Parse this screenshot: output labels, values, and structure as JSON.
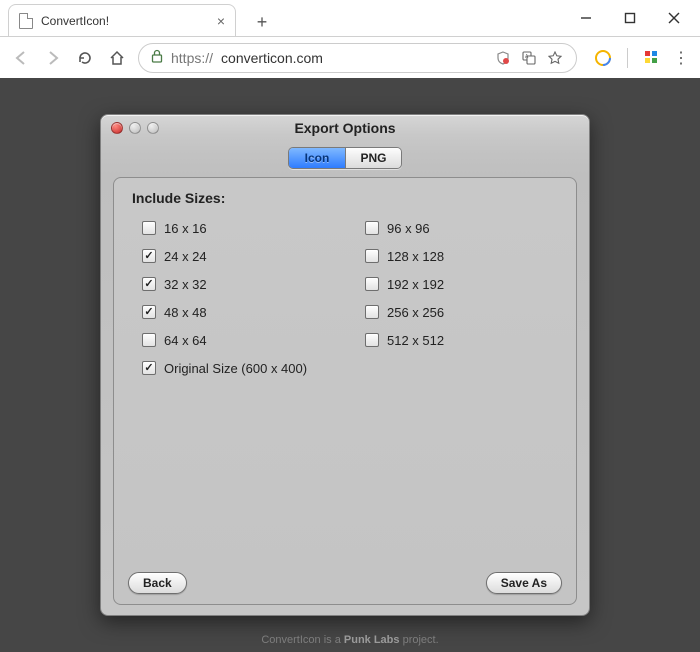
{
  "browser": {
    "tab_title": "ConvertIcon!",
    "url_scheme": "https://",
    "url_host": "converticon.com"
  },
  "dialog": {
    "title": "Export Options",
    "tabs": {
      "icon": "Icon",
      "png": "PNG",
      "selected": "icon"
    },
    "section_title": "Include Sizes:",
    "sizes_left": [
      {
        "label": "16 x 16",
        "checked": false
      },
      {
        "label": "24 x 24",
        "checked": true
      },
      {
        "label": "32 x 32",
        "checked": true
      },
      {
        "label": "48 x 48",
        "checked": true
      },
      {
        "label": "64 x 64",
        "checked": false
      },
      {
        "label": "Original Size (600 x 400)",
        "checked": true
      }
    ],
    "sizes_right": [
      {
        "label": "96 x 96",
        "checked": false
      },
      {
        "label": "128 x 128",
        "checked": false
      },
      {
        "label": "192 x 192",
        "checked": false
      },
      {
        "label": "256 x 256",
        "checked": false
      },
      {
        "label": "512 x 512",
        "checked": false
      }
    ],
    "buttons": {
      "back": "Back",
      "save_as": "Save As"
    }
  },
  "footer": {
    "pre": "ConvertIcon is a ",
    "brand": "Punk Labs",
    "post": " project."
  }
}
